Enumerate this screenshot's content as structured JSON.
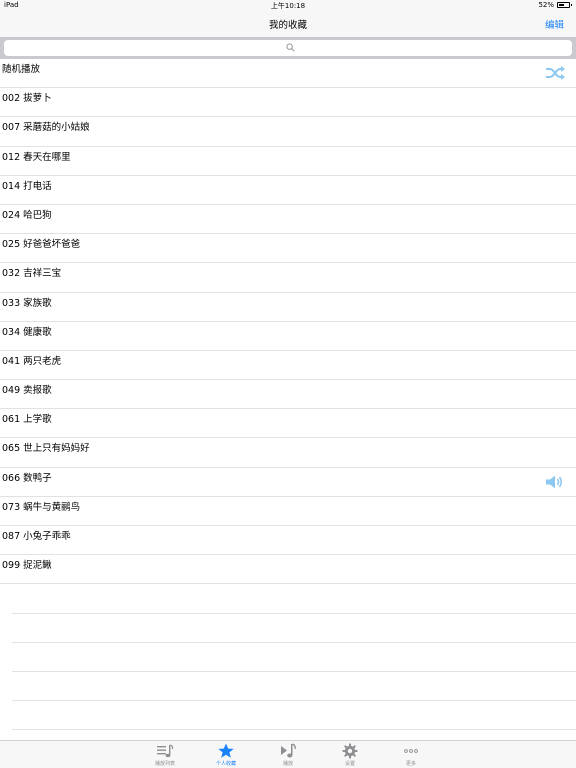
{
  "status_bar": {
    "device": "iPad",
    "time": "上午10:18",
    "battery": "52%",
    "battery_level": 0.52
  },
  "nav": {
    "title": "我的收藏",
    "edit_label": "编辑"
  },
  "search": {
    "icon": "search-icon"
  },
  "list": {
    "shuffle_label": "随机播放",
    "shuffle_icon": "shuffle-icon",
    "items": [
      "002 拔萝卜",
      "007 采蘑菇的小姑娘",
      "012 春天在哪里",
      "014 打电话",
      "024 哈巴狗",
      "025 好爸爸坏爸爸",
      "032 吉祥三宝",
      "033 家族歌",
      "034 健康歌",
      "041 两只老虎",
      "049 卖报歌",
      "061 上学歌",
      "065 世上只有妈妈好",
      "066 数鸭子",
      "073 蜗牛与黄鹂鸟",
      "087 小兔子乖乖",
      "099 捉泥鳅"
    ],
    "now_playing_index": 13,
    "now_playing_icon": "speaker-icon"
  },
  "tab_bar": {
    "tabs": [
      {
        "label": "播放列表",
        "icon": "playlist-icon"
      },
      {
        "label": "个人收藏",
        "icon": "star-icon"
      },
      {
        "label": "播放",
        "icon": "music-note-icon"
      },
      {
        "label": "设置",
        "icon": "gear-icon"
      },
      {
        "label": "更多",
        "icon": "more-icon"
      }
    ],
    "active_index": 1
  },
  "colors": {
    "accent": "#1a82fb",
    "icon_light_blue": "#8ec8f0",
    "tab_inactive": "#8e8e93",
    "separator": "#e2e2e2"
  }
}
